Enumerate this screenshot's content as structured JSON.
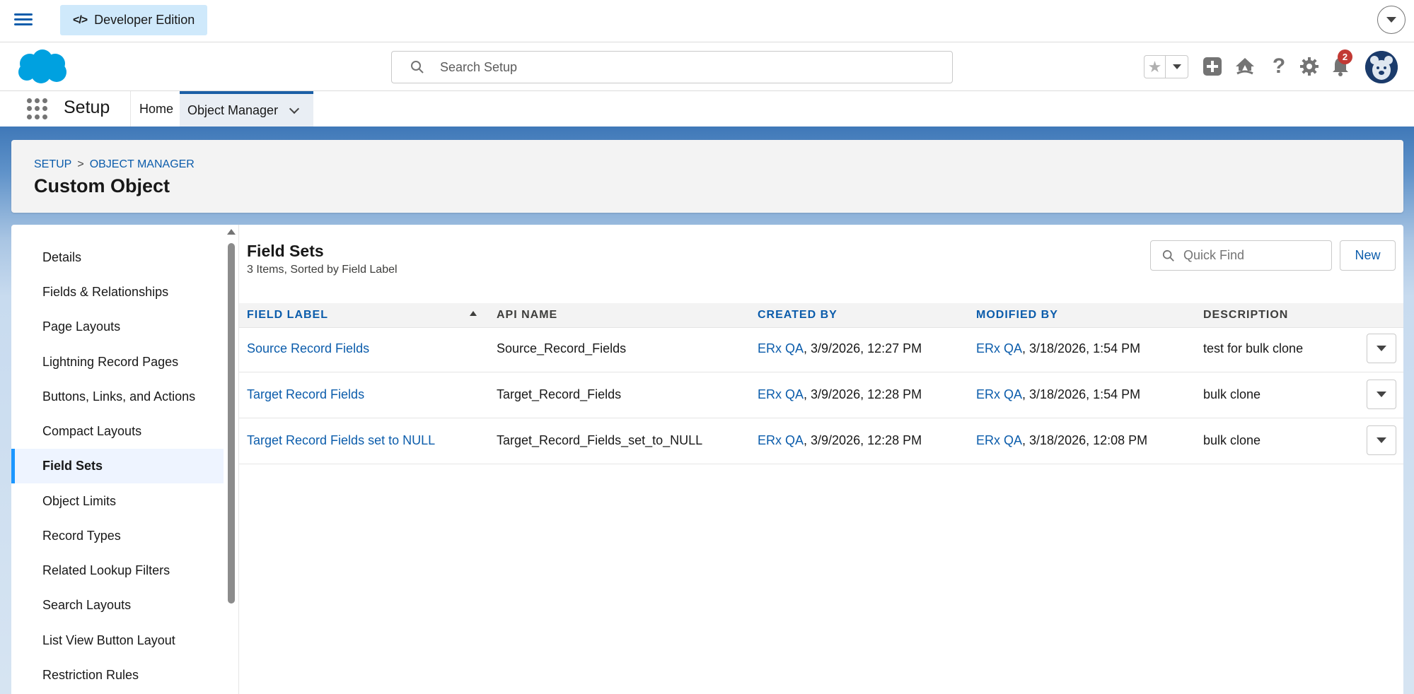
{
  "topbar": {
    "edition_label": "Developer Edition",
    "edition_icon": "code-icon"
  },
  "header": {
    "search_placeholder": "Search Setup",
    "notification_count": "2",
    "icons": [
      "favorites-star-icon",
      "add-icon",
      "trailhead-icon",
      "help-icon",
      "gear-icon",
      "bell-icon",
      "avatar"
    ]
  },
  "appnav": {
    "app_name": "Setup",
    "tabs": [
      {
        "label": "Home"
      },
      {
        "label": "Object Manager"
      }
    ]
  },
  "page": {
    "breadcrumb": [
      "SETUP",
      "OBJECT MANAGER"
    ],
    "breadcrumb_sep": ">",
    "title": "Custom Object"
  },
  "sidebar": {
    "items": [
      {
        "label": "Details"
      },
      {
        "label": "Fields & Relationships"
      },
      {
        "label": "Page Layouts"
      },
      {
        "label": "Lightning Record Pages"
      },
      {
        "label": "Buttons, Links, and Actions"
      },
      {
        "label": "Compact Layouts"
      },
      {
        "label": "Field Sets"
      },
      {
        "label": "Object Limits"
      },
      {
        "label": "Record Types"
      },
      {
        "label": "Related Lookup Filters"
      },
      {
        "label": "Search Layouts"
      },
      {
        "label": "List View Button Layout"
      },
      {
        "label": "Restriction Rules"
      }
    ],
    "active": "Field Sets"
  },
  "content": {
    "title": "Field Sets",
    "subtitle": "3 Items, Sorted by Field Label",
    "quickfind_placeholder": "Quick Find",
    "new_label": "New",
    "columns": [
      "FIELD LABEL",
      "API NAME",
      "CREATED BY",
      "MODIFIED BY",
      "DESCRIPTION"
    ],
    "rows": [
      {
        "label": "Source Record Fields",
        "api": "Source_Record_Fields",
        "created_user": "ERx QA",
        "created_date": ", 3/9/2026, 12:27 PM",
        "modified_user": "ERx QA",
        "modified_date": ", 3/18/2026, 1:54 PM",
        "description": "test for bulk clone"
      },
      {
        "label": "Target Record Fields",
        "api": "Target_Record_Fields",
        "created_user": "ERx QA",
        "created_date": ", 3/9/2026, 12:28 PM",
        "modified_user": "ERx QA",
        "modified_date": ", 3/18/2026, 1:54 PM",
        "description": "bulk clone"
      },
      {
        "label": "Target Record Fields set to NULL",
        "api": "Target_Record_Fields_set_to_NULL",
        "created_user": "ERx QA",
        "created_date": ", 3/9/2026, 12:28 PM",
        "modified_user": "ERx QA",
        "modified_date": ", 3/18/2026, 12:08 PM",
        "description": "bulk clone"
      }
    ]
  },
  "colors": {
    "brand_blue": "#0b5cab",
    "salesforce_cloud": "#00a1e0",
    "active_accent": "#1b96ff",
    "badge_red": "#c23934"
  }
}
